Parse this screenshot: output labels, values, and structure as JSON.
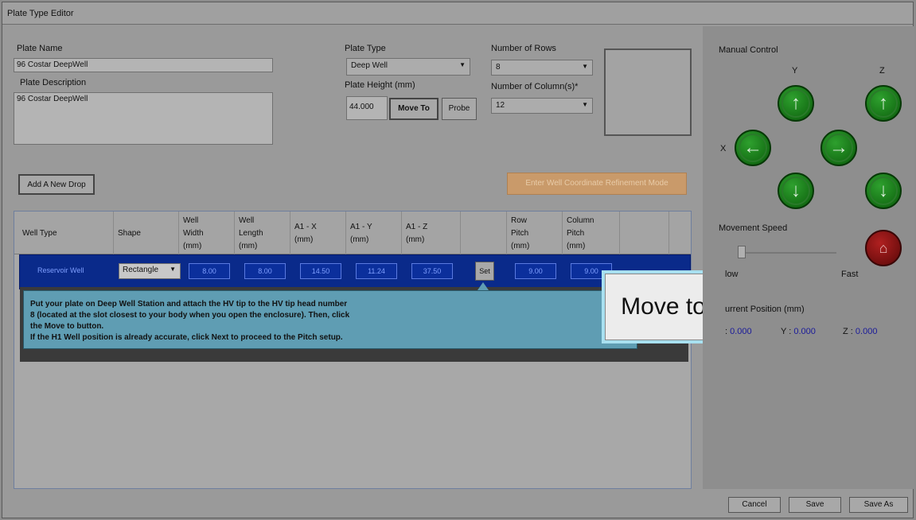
{
  "window": {
    "title": "Plate Type Editor"
  },
  "plate_name": {
    "label": "Plate Name",
    "value": "96 Costar DeepWell"
  },
  "plate_description": {
    "label": "Plate Description",
    "value": "96 Costar DeepWell"
  },
  "plate_type": {
    "label": "Plate Type",
    "value": "Deep Well"
  },
  "plate_height": {
    "label": "Plate Height (mm)",
    "value": "44.000",
    "move_to": "Move To",
    "probe": "Probe"
  },
  "rows": {
    "label": "Number of Rows",
    "value": "8"
  },
  "columns": {
    "label": "Number of Column(s)*",
    "value": "12"
  },
  "buttons": {
    "add_drop": "Add A New Drop",
    "refinement": "Enter Well Coordinate Refinement Mode"
  },
  "grid": {
    "headers": {
      "well_type": "Well Type",
      "shape": "Shape",
      "well_width": [
        "Well",
        "Width",
        "(mm)"
      ],
      "well_length": [
        "Well",
        "Length",
        "(mm)"
      ],
      "a1_x": [
        "A1 - X",
        "(mm)"
      ],
      "a1_y": [
        "A1 - Y",
        "(mm)"
      ],
      "a1_z": [
        "A1 - Z",
        "(mm)"
      ],
      "row_pitch": [
        "Row",
        "Pitch",
        "(mm)"
      ],
      "col_pitch": [
        "Column",
        "Pitch",
        "(mm)"
      ]
    },
    "row": {
      "well_type": "Reservoir Well",
      "shape": "Rectangle",
      "width": "8.00",
      "length": "8.00",
      "a1_x": "14.50",
      "a1_y": "11.24",
      "a1_z": "37.50",
      "set": "Set",
      "row_pitch": "9.00",
      "col_pitch": "9.00"
    }
  },
  "tooltip": {
    "line1": "Put your plate on Deep Well Station and attach the HV tip to the HV tip head number",
    "line2": "8 (located at the slot closest to your body when you open the enclosure). Then, click",
    "line3": "the Move to button.",
    "line4": "If the H1 Well position is already accurate, click Next to proceed to the Pitch setup."
  },
  "callout": {
    "label": "Move to"
  },
  "manual_control": {
    "title": "Manual Control",
    "y_label": "Y",
    "z_label": "Z",
    "x_label": "X",
    "speed_label": "Movement Speed",
    "slow_label": "low",
    "fast_label": "Fast",
    "position_label": "urrent Position (mm)",
    "x_pos_label": ":",
    "x_pos": "0.000",
    "y_pos_label": "Y :",
    "y_pos": "0.000",
    "z_pos_label": "Z :",
    "z_pos": "0.000"
  },
  "footer": {
    "cancel": "Cancel",
    "save": "Save",
    "save_as": "Save As"
  }
}
